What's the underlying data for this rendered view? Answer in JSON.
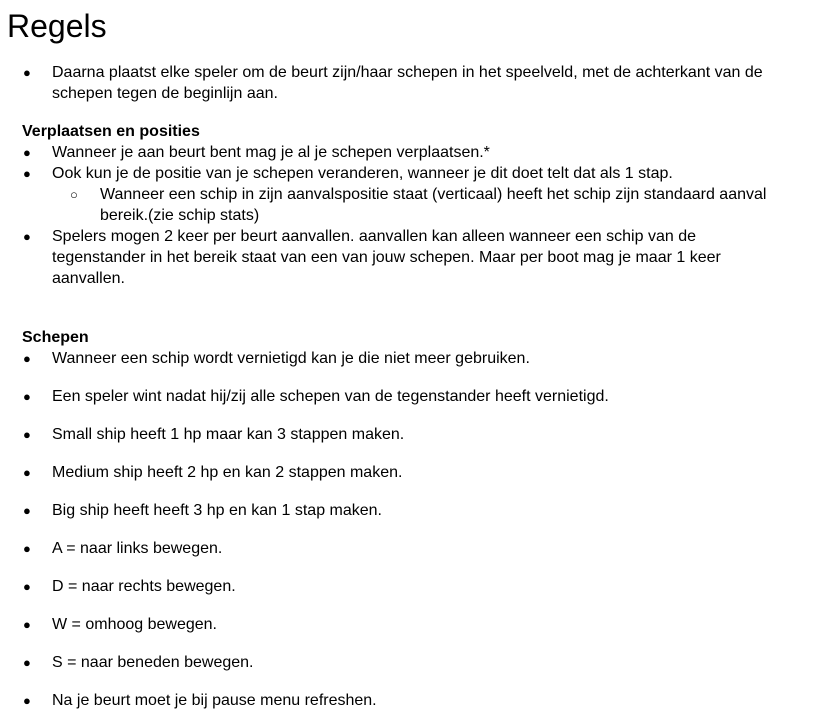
{
  "title": "Regels",
  "intro": [
    "Daarna plaatst elke speler om de beurt zijn/haar schepen in het speelveld, met de achterkant van de schepen tegen de beginlijn aan."
  ],
  "section1": {
    "heading": "Verplaatsen en posities",
    "item1": "Wanneer je aan beurt bent mag je al je schepen verplaatsen.*",
    "item2": "Ook kun je de positie van je schepen veranderen, wanneer je dit doet telt dat als 1 stap.",
    "sub1": "Wanneer een schip in zijn aanvalspositie staat (verticaal) heeft het schip zijn standaard aanval bereik.(zie schip stats)",
    "item3": "Spelers mogen 2 keer per beurt aanvallen. aanvallen kan alleen wanneer een schip van de tegenstander in het bereik staat van een van jouw schepen. Maar per boot mag je maar 1 keer aanvallen."
  },
  "section2": {
    "heading": "Schepen",
    "items": [
      "Wanneer een schip wordt vernietigd kan je die niet meer gebruiken.",
      "Een speler wint nadat hij/zij alle schepen van de tegenstander heeft vernietigd.",
      "Small ship heeft 1 hp maar kan 3 stappen maken.",
      "Medium ship heeft 2 hp en kan 2 stappen maken.",
      "Big ship heeft heeft 3 hp en kan 1 stap maken.",
      "A = naar links bewegen.",
      "D = naar rechts bewegen.",
      "W = omhoog bewegen.",
      "S = naar beneden bewegen.",
      "Na je beurt moet je bij pause menu refreshen."
    ]
  }
}
